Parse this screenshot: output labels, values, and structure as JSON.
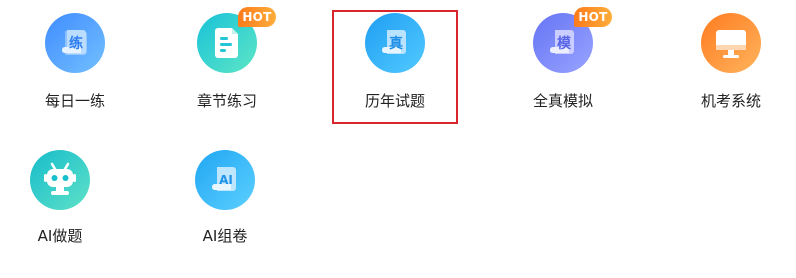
{
  "items": [
    {
      "label": "每日一练",
      "glyph": "练",
      "icon": "daily-practice-icon",
      "colors": [
        "#4d9bff",
        "#6ab8ff"
      ]
    },
    {
      "label": "章节练习",
      "glyph": "",
      "icon": "chapter-practice-icon",
      "colors": [
        "#22c6d6",
        "#57e0c9"
      ],
      "badge": "HOT"
    },
    {
      "label": "历年试题",
      "glyph": "真",
      "icon": "past-papers-icon",
      "colors": [
        "#2aa6f5",
        "#49c4ff"
      ],
      "selected": true
    },
    {
      "label": "全真模拟",
      "glyph": "模",
      "icon": "mock-exam-icon",
      "colors": [
        "#6f7cf6",
        "#8f9bff"
      ],
      "badge": "HOT"
    },
    {
      "label": "机考系统",
      "glyph": "",
      "icon": "computer-exam-icon",
      "colors": [
        "#ff8a2b",
        "#ffa654"
      ]
    },
    {
      "label": "AI做题",
      "glyph": "",
      "icon": "ai-robot-icon",
      "colors": [
        "#20c0cc",
        "#4fdcc9"
      ]
    },
    {
      "label": "AI组卷",
      "glyph": "AI",
      "icon": "ai-paper-icon",
      "colors": [
        "#2ab0f5",
        "#55cbff"
      ]
    }
  ],
  "badge_colors": [
    "#ff7a1a",
    "#ffae3b"
  ],
  "selection_color": "#d9262c"
}
